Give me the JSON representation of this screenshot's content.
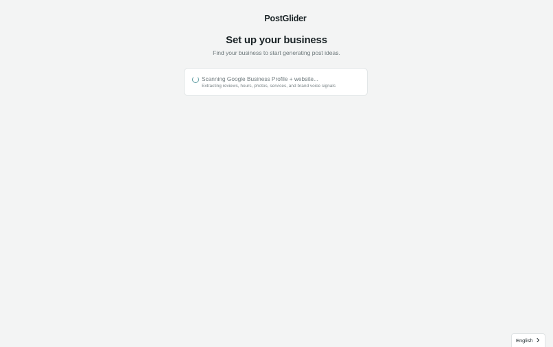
{
  "brand": {
    "name": "PostGlider"
  },
  "header": {
    "title": "Set up your business",
    "subtitle": "Find your business to start generating post ideas."
  },
  "status": {
    "title": "Scanning Google Business Profile + website...",
    "detail": "Extracting reviews, hours, photos, services, and brand voice signals",
    "icon": "spinner-icon",
    "accent_color": "#5a9aa0"
  },
  "language": {
    "selected": "English",
    "icon": "chevron-right-icon"
  }
}
